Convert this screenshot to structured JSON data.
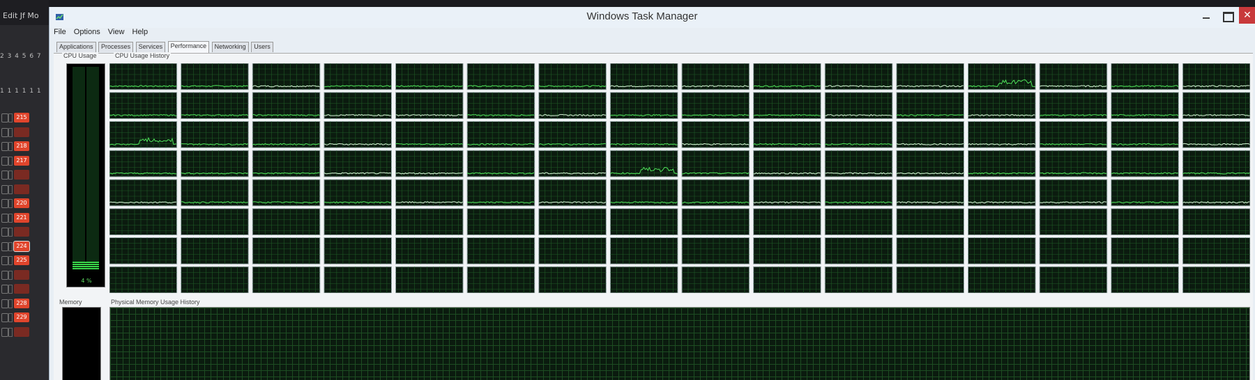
{
  "background_app": {
    "menu_text": "Edit   Jf  Mo",
    "number_row": "2 3 4 5 6 7",
    "ones_row": "1 1 1 1 1 1",
    "chips": [
      "215",
      "",
      "218",
      "217",
      "",
      "",
      "220",
      "221",
      "",
      "224",
      "225",
      "",
      "",
      "228",
      "229",
      ""
    ]
  },
  "window": {
    "title": "Windows Task Manager",
    "close_glyph": "✕"
  },
  "menu": [
    "File",
    "Options",
    "View",
    "Help"
  ],
  "tabs": [
    {
      "label": "Applications",
      "active": false
    },
    {
      "label": "Processes",
      "active": false
    },
    {
      "label": "Services",
      "active": false
    },
    {
      "label": "Performance",
      "active": true
    },
    {
      "label": "Networking",
      "active": false
    },
    {
      "label": "Users",
      "active": false
    }
  ],
  "cpu": {
    "usage_label": "CPU Usage",
    "history_label": "CPU Usage History",
    "usage_percent_text": "4 %",
    "usage_percent": 4,
    "grid": {
      "cols": 16,
      "rows": 8
    },
    "active_graphs": [
      [
        0,
        0
      ],
      [
        1,
        0
      ],
      [
        2,
        0
      ],
      [
        3,
        0
      ],
      [
        4,
        0
      ],
      [
        5,
        0
      ],
      [
        6,
        0
      ],
      [
        7,
        0
      ],
      [
        8,
        0
      ],
      [
        9,
        0
      ],
      [
        10,
        0
      ],
      [
        11,
        0
      ],
      [
        12,
        0
      ],
      [
        13,
        0
      ],
      [
        14,
        0
      ],
      [
        15,
        0
      ],
      [
        0,
        1
      ],
      [
        1,
        1
      ],
      [
        2,
        1
      ],
      [
        3,
        1
      ],
      [
        4,
        1
      ],
      [
        5,
        1
      ],
      [
        6,
        1
      ],
      [
        7,
        1
      ],
      [
        8,
        1
      ],
      [
        9,
        1
      ],
      [
        10,
        1
      ],
      [
        11,
        1
      ],
      [
        12,
        1
      ],
      [
        13,
        1
      ],
      [
        14,
        1
      ],
      [
        15,
        1
      ],
      [
        0,
        2
      ],
      [
        1,
        2
      ],
      [
        2,
        2
      ],
      [
        3,
        2
      ],
      [
        4,
        2
      ],
      [
        5,
        2
      ],
      [
        6,
        2
      ],
      [
        7,
        2
      ],
      [
        8,
        2
      ],
      [
        9,
        2
      ],
      [
        10,
        2
      ],
      [
        11,
        2
      ],
      [
        12,
        2
      ],
      [
        13,
        2
      ],
      [
        14,
        2
      ],
      [
        15,
        2
      ],
      [
        0,
        3
      ],
      [
        1,
        3
      ],
      [
        2,
        3
      ],
      [
        3,
        3
      ],
      [
        4,
        3
      ],
      [
        5,
        3
      ],
      [
        6,
        3
      ],
      [
        7,
        3
      ],
      [
        8,
        3
      ],
      [
        9,
        3
      ],
      [
        10,
        3
      ],
      [
        11,
        3
      ],
      [
        12,
        3
      ],
      [
        13,
        3
      ],
      [
        14,
        3
      ],
      [
        15,
        3
      ],
      [
        0,
        4
      ],
      [
        1,
        4
      ],
      [
        2,
        4
      ],
      [
        3,
        4
      ],
      [
        4,
        4
      ],
      [
        5,
        4
      ],
      [
        6,
        4
      ],
      [
        7,
        4
      ],
      [
        8,
        4
      ],
      [
        9,
        4
      ],
      [
        10,
        4
      ],
      [
        11,
        4
      ],
      [
        12,
        4
      ],
      [
        13,
        4
      ],
      [
        14,
        4
      ],
      [
        15,
        4
      ]
    ],
    "spike_graphs": [
      [
        0,
        2
      ],
      [
        12,
        0
      ],
      [
        7,
        3
      ]
    ]
  },
  "memory": {
    "usage_label": "Memory",
    "history_label": "Physical Memory Usage History"
  },
  "colors": {
    "graph_bg": "#0b1b0f",
    "graph_grid": "#1f5a26",
    "line_green": "#4fe35a",
    "line_white": "#d8f5d8",
    "close_red": "#c8393b"
  }
}
